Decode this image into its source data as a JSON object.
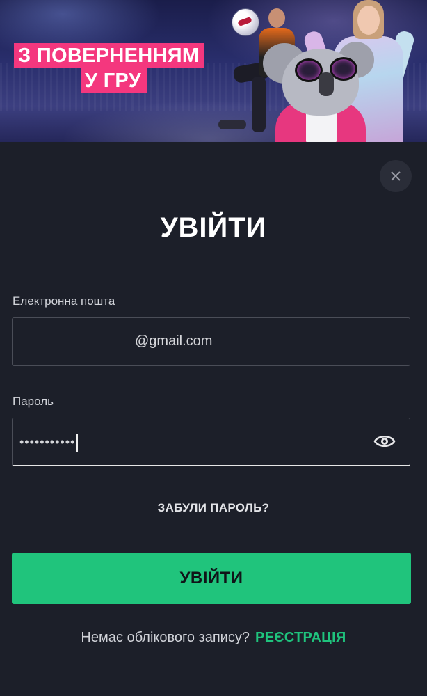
{
  "banner": {
    "title_line1": "З ПОВЕРНЕННЯМ",
    "title_line2": "У ГРУ",
    "accent_color": "#f4377e"
  },
  "modal": {
    "title": "УВІЙТИ",
    "close_icon": "close-icon"
  },
  "form": {
    "email_label": "Електронна пошта",
    "email_value": "@gmail.com",
    "password_label": "Пароль",
    "password_value": "•••••••••••",
    "show_password_icon": "eye-icon",
    "forgot_password": "ЗАБУЛИ ПАРОЛЬ?",
    "submit_label": "УВІЙТИ",
    "submit_color": "#20c47c"
  },
  "footer": {
    "no_account_text": "Немає облікового запису?",
    "register_link": "РЕЄСТРАЦІЯ",
    "register_color": "#1fc37d"
  }
}
